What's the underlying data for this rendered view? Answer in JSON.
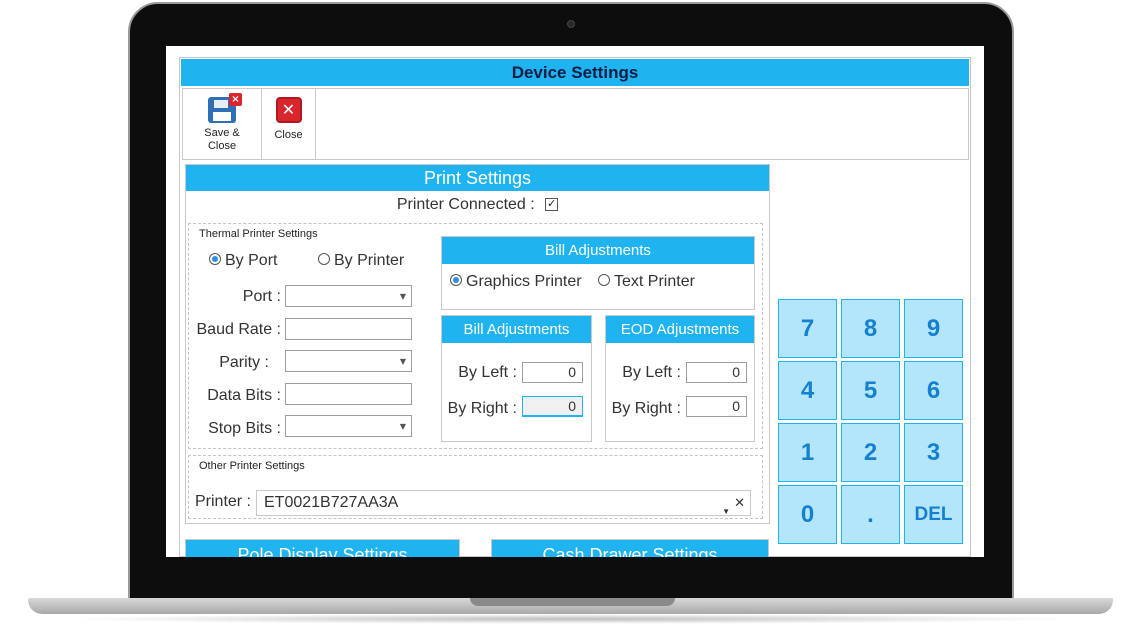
{
  "window": {
    "title": "Device Settings"
  },
  "toolbar": {
    "save_close_label_1": "Save &",
    "save_close_label_2": "Close",
    "close_label": "Close"
  },
  "print_settings": {
    "header": "Print Settings",
    "printer_connected_label": "Printer Connected :",
    "printer_connected": true,
    "thermal": {
      "title": "Thermal Printer Settings",
      "mode_by_port": "By Port",
      "mode_by_printer": "By Printer",
      "selected_mode": "By Port",
      "port_label": "Port :",
      "port_value": "",
      "baud_rate_label": "Baud Rate :",
      "baud_rate_value": "",
      "parity_label": "Parity :",
      "parity_value": "",
      "data_bits_label": "Data Bits :",
      "data_bits_value": "",
      "stop_bits_label": "Stop Bits :",
      "stop_bits_value": ""
    },
    "bill_type": {
      "header": "Bill Adjustments",
      "graphics_printer": "Graphics Printer",
      "text_printer": "Text Printer",
      "selected": "Graphics Printer"
    },
    "bill_adjustments": {
      "header": "Bill Adjustments",
      "by_left_label": "By Left :",
      "by_left_value": "0",
      "by_right_label": "By Right :",
      "by_right_value": "0"
    },
    "eod_adjustments": {
      "header": "EOD Adjustments",
      "by_left_label": "By Left :",
      "by_left_value": "0",
      "by_right_label": "By Right :",
      "by_right_value": "0"
    },
    "other": {
      "title": "Other Printer Settings",
      "printer_label": "Printer :",
      "printer_value": "ET0021B727AA3A"
    }
  },
  "pole_display": {
    "header": "Pole Display Settings"
  },
  "cash_drawer": {
    "header": "Cash Drawer Settings"
  },
  "keypad": {
    "keys": [
      "7",
      "8",
      "9",
      "4",
      "5",
      "6",
      "1",
      "2",
      "3",
      "0",
      ".",
      "DEL"
    ]
  },
  "colors": {
    "accent": "#1fb3f0",
    "title_text": "#0b1d45",
    "key_bg": "#b3e6fb",
    "key_text": "#1480ce"
  },
  "icons": {
    "save_close": "floppy-disk-with-x-icon",
    "close": "red-x-icon"
  }
}
